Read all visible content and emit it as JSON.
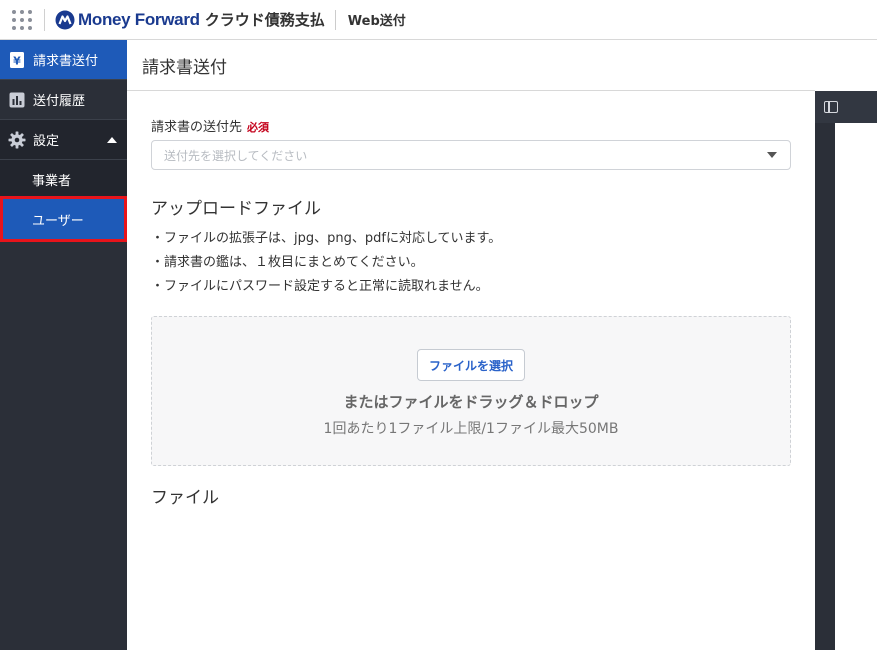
{
  "header": {
    "logo_text": "Money Forward",
    "product_name": "クラウド債務支払",
    "service_name": "Web送付",
    "brand_color": "#1a3a8f"
  },
  "sidebar": {
    "items": [
      {
        "label": "請求書送付",
        "icon": "yen-document-icon",
        "state": "active"
      },
      {
        "label": "送付履歴",
        "icon": "bar-chart-icon"
      },
      {
        "label": "設定",
        "icon": "gear-icon",
        "state": "expanded"
      }
    ],
    "sub_items": [
      {
        "label": "事業者"
      },
      {
        "label": "ユーザー",
        "state": "selected"
      }
    ]
  },
  "main": {
    "page_title": "請求書送付",
    "recipient": {
      "label": "請求書の送付先",
      "required_label": "必須",
      "placeholder": "送付先を選択してください"
    },
    "upload": {
      "title": "アップロードファイル",
      "notes": [
        "・ファイルの拡張子は、jpg、png、pdfに対応しています。",
        "・請求書の鑑は、１枚目にまとめてください。",
        "・ファイルにパスワード設定すると正常に読取れません。"
      ],
      "select_button": "ファイルを選択",
      "drop_text": "またはファイルをドラッグ＆ドロップ",
      "limit_text": "1回あたり1ファイル上限/1ファイル最大50MB"
    },
    "files_title": "ファイル"
  },
  "colors": {
    "sidebar_bg": "#2b2f38",
    "active_bg": "#1e5ab8",
    "highlight_border": "#e8141b",
    "required": "#c4001a"
  }
}
